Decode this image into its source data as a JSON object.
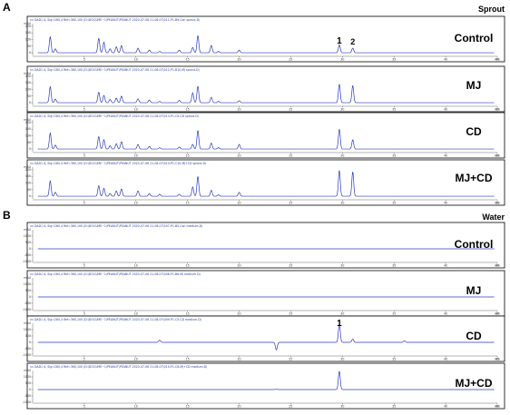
{
  "figure": {
    "panels": [
      {
        "id": "A",
        "letter": "A",
        "tag": "Sprout",
        "rows": [
          {
            "label": "Control",
            "header": "DAD1 A, Sig=280,4 Ref=360,100 (D:\\DOCUME~1\\PEANUT\\PEANUT 2020-07-06 21-08-07\\011-P1-B9-Con sprout.D)"
          },
          {
            "label": "MJ",
            "header": "DAD1 A, Sig=280,4 Ref=360,100 (D:\\DOCUME~1\\PEANUT\\PEANUT 2020-07-06 21-08-07\\012-P1-B10-MJ sprout.D)"
          },
          {
            "label": "CD",
            "header": "DAD1 A, Sig=280,4 Ref=360,100 (D:\\DOCUME~1\\PEANUT\\PEANUT 2020-07-06 21-08-07\\013-P1-C9-CD sprout.D)"
          },
          {
            "label": "MJ+CD",
            "header": "DAD1 A, Sig=280,4 Ref=360,100 (D:\\DOCUME~1\\PEANUT\\PEANUT 2020-07-06 21-08-07\\014-P1-C10-MJ+CD sprout.D)"
          }
        ],
        "peak_labels": [
          "1",
          "2"
        ]
      },
      {
        "id": "B",
        "letter": "B",
        "tag": "Water",
        "rows": [
          {
            "label": "Control",
            "header": "DAD1 A, Sig=280,4 Ref=360,100 (D:\\DOCUME~1\\PEANUT\\PEANUT 2020-07-06 21-08-07\\007-P1-B5-Con medium.D)"
          },
          {
            "label": "MJ",
            "header": "DAD1 A, Sig=280,4 Ref=360,100 (D:\\DOCUME~1\\PEANUT\\PEANUT 2020-07-06 21-08-07\\008-P1-B6-MJ medium.D)"
          },
          {
            "label": "CD",
            "header": "DAD1 A, Sig=280,4 Ref=360,100 (D:\\DOCUME~1\\PEANUT\\PEANUT 2020-07-06 21-08-07\\009-P1-C5-CD medium.D)"
          },
          {
            "label": "MJ+CD",
            "header": "DAD1 A, Sig=280,4 Ref=360,100 (D:\\DOCUME~1\\PEANUT\\PEANUT 2020-07-06 21-08-07\\010-P1-C6-MJ+CD medium.D)"
          }
        ],
        "peak_labels": [
          "1"
        ]
      }
    ],
    "y_unit": "mAU",
    "x_unit": "min"
  },
  "chart_data": [
    {
      "type": "line",
      "panel": "A",
      "title": "Sprout",
      "xlabel": "min",
      "ylabel": "mAU",
      "xlim": [
        0,
        45
      ],
      "x_ticks": [
        5,
        10,
        15,
        20,
        25,
        30,
        35,
        40,
        45
      ],
      "y_ticks": [
        0,
        50,
        100,
        150,
        200
      ],
      "ylim": [
        -20,
        220
      ],
      "trace_color": "#2b3bbf",
      "peaks_rt": [
        1.7,
        2.2,
        6.4,
        6.9,
        7.5,
        8.1,
        8.6,
        10.2,
        11.3,
        12.3,
        14.2,
        15.5,
        16.0,
        17.3,
        18.0,
        20.0,
        29.7,
        31.0
      ],
      "series": [
        {
          "name": "Control",
          "heights": [
            120,
            30,
            110,
            80,
            30,
            45,
            55,
            35,
            20,
            10,
            20,
            40,
            130,
            55,
            10,
            20,
            60,
            35
          ]
        },
        {
          "name": "MJ",
          "heights": [
            120,
            28,
            80,
            55,
            25,
            35,
            50,
            30,
            20,
            10,
            18,
            75,
            125,
            40,
            10,
            15,
            140,
            130
          ]
        },
        {
          "name": "CD",
          "heights": [
            120,
            30,
            95,
            70,
            25,
            40,
            55,
            35,
            20,
            10,
            15,
            35,
            140,
            45,
            10,
            35,
            150,
            70
          ]
        },
        {
          "name": "MJ+CD",
          "heights": [
            115,
            30,
            80,
            60,
            20,
            40,
            55,
            40,
            20,
            15,
            15,
            70,
            150,
            45,
            10,
            30,
            195,
            185
          ]
        }
      ]
    },
    {
      "type": "line",
      "panel": "B",
      "title": "Water",
      "xlabel": "min",
      "ylabel": "mAU",
      "xlim": [
        0,
        45
      ],
      "x_ticks": [
        5,
        10,
        15,
        20,
        25,
        30,
        35,
        40,
        45
      ],
      "y_ticks": [
        -1000,
        -500,
        0,
        500,
        1000,
        1500
      ],
      "ylim": [
        -1000,
        1500
      ],
      "trace_color": "#2b3bbf",
      "peaks_rt": [
        12.3,
        23.6,
        29.7,
        31.0,
        36.0
      ],
      "series": [
        {
          "name": "Control",
          "heights": [
            0,
            0,
            0,
            0,
            0
          ]
        },
        {
          "name": "MJ",
          "heights": [
            0,
            0,
            0,
            0,
            0
          ]
        },
        {
          "name": "CD",
          "heights": [
            180,
            -600,
            1450,
            260,
            120
          ]
        },
        {
          "name": "MJ+CD",
          "heights": [
            0,
            30,
            1450,
            0,
            0
          ]
        }
      ]
    }
  ]
}
